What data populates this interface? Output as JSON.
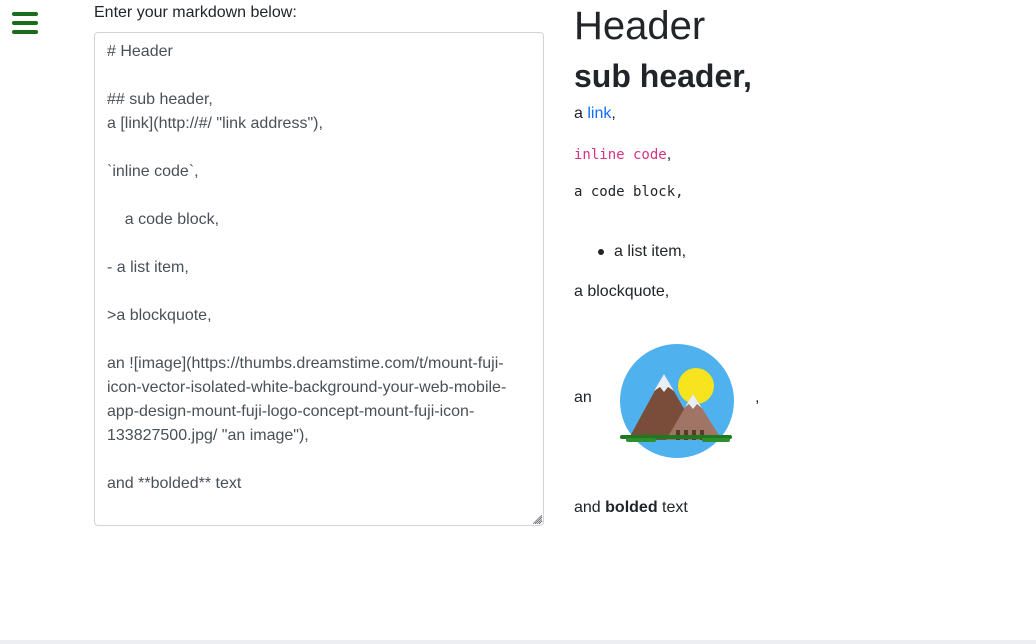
{
  "editor": {
    "label": "Enter your markdown below:",
    "value": "# Header\n\n## sub header,\na [link](http://#/ \"link address\"),\n\n`inline code`,\n\n    a code block,\n\n- a list item,\n\n>a blockquote,\n\nan ![image](https://thumbs.dreamstime.com/t/mount-fuji-icon-vector-isolated-white-background-your-web-mobile-app-design-mount-fuji-logo-concept-mount-fuji-icon-133827500.jpg/ \"an image\"),\n\nand **bolded** text"
  },
  "preview": {
    "h1": "Header",
    "h2": "sub header,",
    "link_prefix": "a",
    "link_text": "link",
    "link_suffix": ",",
    "inline_code": "inline code",
    "inline_code_suffix": ",",
    "code_block": "a code block,",
    "list_items": [
      "a list item,"
    ],
    "blockquote": "a blockquote,",
    "image_prefix": "an",
    "image_suffix": ",",
    "bold_prefix": "and",
    "bold_text": "bolded",
    "bold_suffix": "text"
  },
  "icons": {
    "menu": "hamburger-menu-icon",
    "image": "mount-fuji-icon"
  },
  "colors": {
    "menu": "#1a6b1a",
    "link": "#0d6efd",
    "inline_code": "#d63384",
    "text": "#212529",
    "editor_text": "#495057",
    "editor_border": "#ced4da",
    "image_sky": "#4fb1ee",
    "image_sun": "#f7e31e",
    "image_mountain_dark": "#7a4d3a",
    "image_mountain_light": "#a07565",
    "image_grass": "#1f7a1f"
  }
}
